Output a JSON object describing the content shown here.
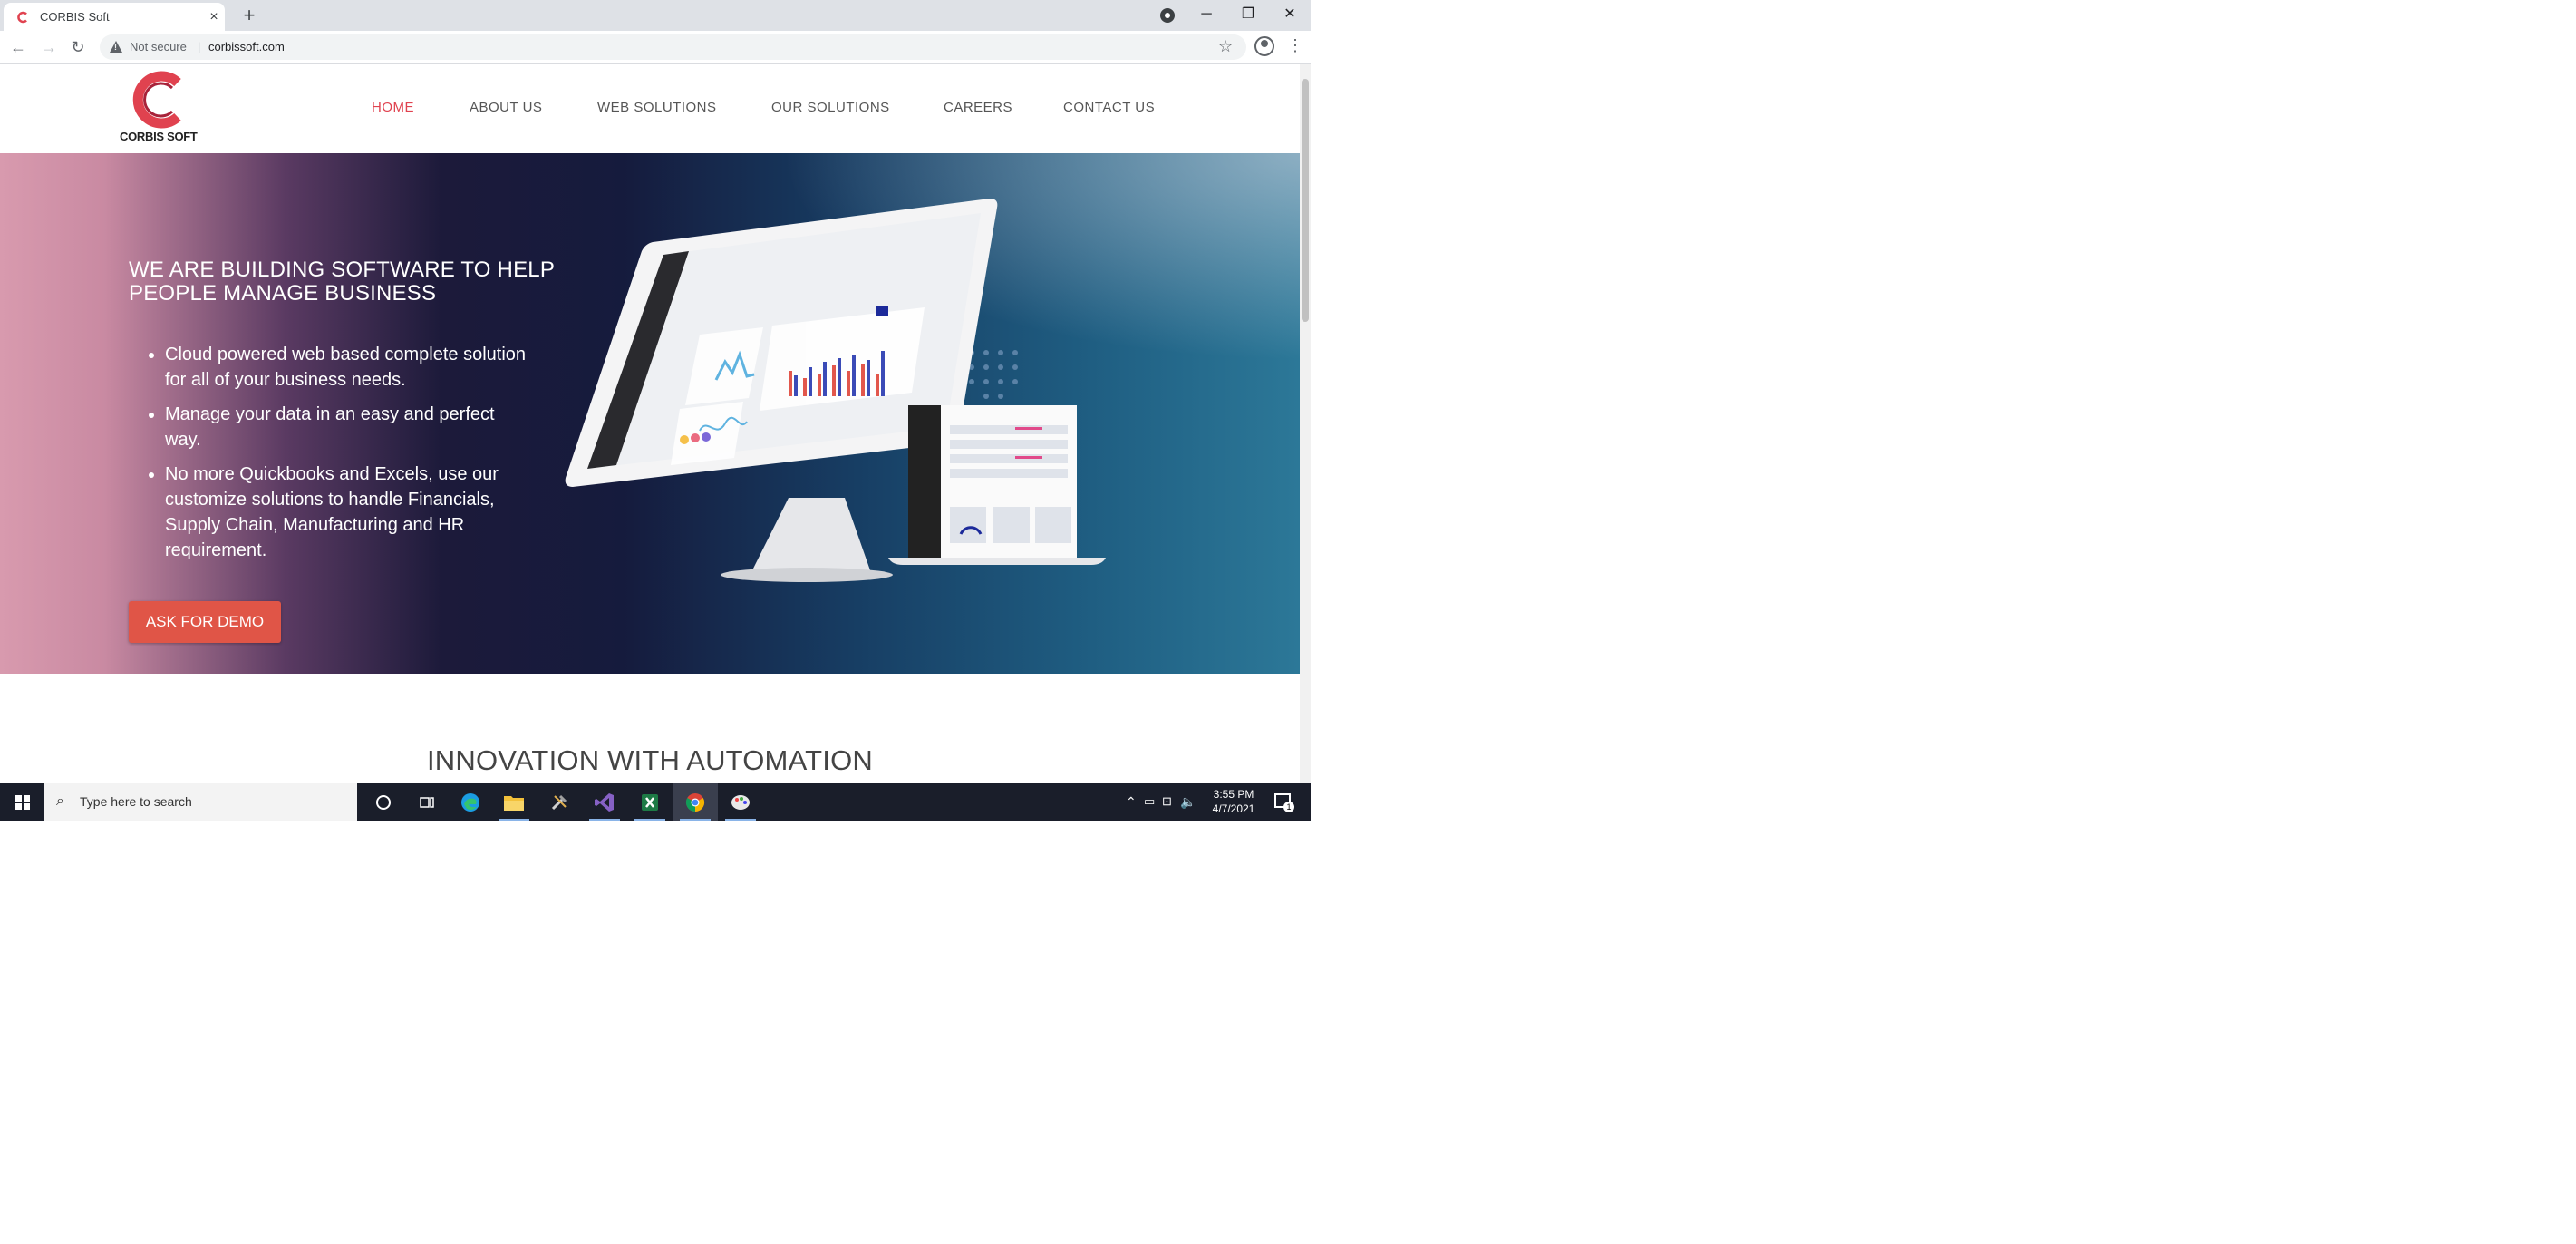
{
  "browser": {
    "tab_title": "CORBIS Soft",
    "tab_close": "×",
    "new_tab": "+",
    "window_controls": {
      "minimize": "─",
      "restore": "❐",
      "close": "✕"
    },
    "security_label": "Not secure",
    "separator": "|",
    "url": "corbissoft.com"
  },
  "site": {
    "logo_text": "CORBIS SOFT",
    "brand_color": "#e0424f",
    "nav": [
      "HOME",
      "ABOUT US",
      "WEB SOLUTIONS",
      "OUR SOLUTIONS",
      "CAREERS",
      "CONTACT US"
    ],
    "hero": {
      "title": "WE ARE BUILDING SOFTWARE TO HELP PEOPLE MANAGE BUSINESS",
      "bullets": [
        "Cloud powered web based complete solution for all of your business needs.",
        "Manage your data in an easy and perfect way.",
        "No more Quickbooks and Excels, use our customize solutions to handle Financials, Supply Chain, Manufacturing and HR requirement."
      ],
      "cta": "ASK FOR DEMO",
      "cta_color": "#e05547"
    },
    "section_title": "INNOVATION WITH AUTOMATION"
  },
  "taskbar": {
    "search_placeholder": "Type here to search",
    "time": "3:55 PM",
    "date": "4/7/2021",
    "notification_count": "1",
    "pinned_icons": [
      "cortana-icon",
      "task-view-icon",
      "edge-icon",
      "file-explorer-icon",
      "tools-icon",
      "visual-studio-icon",
      "excel-icon",
      "chrome-icon",
      "paint-icon"
    ]
  }
}
